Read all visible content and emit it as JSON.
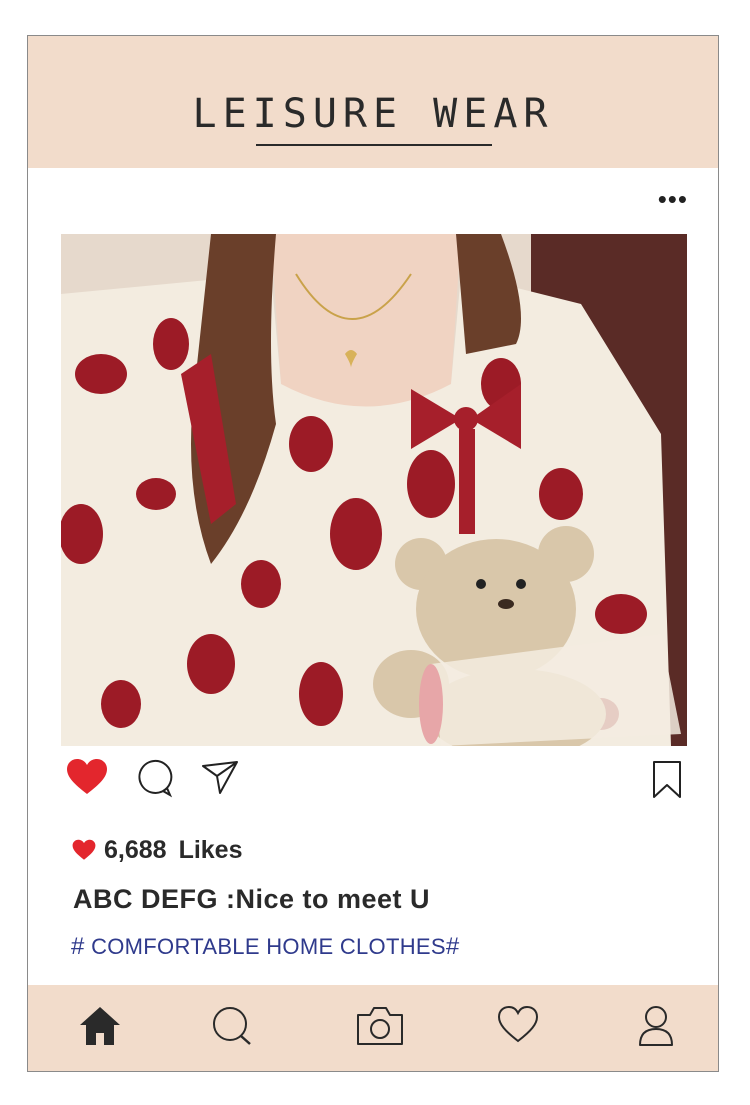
{
  "header": {
    "title": "LEISURE WEAR"
  },
  "post": {
    "menu_label": "•••",
    "likes_count": "6,688",
    "likes_label": "Likes",
    "caption": "ABC DEFG :Nice to meet U",
    "hashtag_prefix": "#",
    "hashtag_text": "COMFORTABLE HOME CLOTHES",
    "hashtag_suffix": "#"
  },
  "actions": [
    "heart-icon",
    "comment-icon",
    "share-icon",
    "bookmark-icon"
  ],
  "nav": [
    "home-icon",
    "search-icon",
    "camera-icon",
    "heart-icon",
    "profile-icon"
  ],
  "colors": {
    "header_bg": "#f2dccb",
    "like_red": "#e3262d",
    "hashtag_blue": "#2f3a8c",
    "text": "#2a2a2a"
  }
}
